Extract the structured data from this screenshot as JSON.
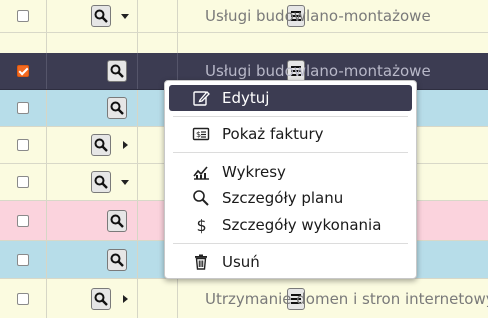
{
  "colors": {
    "row_yellow": "#fbfbe0",
    "row_selected": "#3c3c52",
    "row_blue": "#b7dde9",
    "row_pink": "#fbd3dd",
    "accent_checkbox": "#f26a21"
  },
  "rows": [
    {
      "checked": false,
      "expander": "down",
      "name": "Usługi budowlano-montażowe",
      "bg": "yellow"
    },
    {
      "checked": true,
      "expander": "none",
      "name": "Usługi budowlano-montażowe",
      "bg": "selected"
    },
    {
      "checked": false,
      "expander": "none",
      "name": "",
      "bg": "blue"
    },
    {
      "checked": false,
      "expander": "right",
      "name": "",
      "bg": "yellow"
    },
    {
      "checked": false,
      "expander": "down",
      "name": "",
      "bg": "yellow"
    },
    {
      "checked": false,
      "expander": "none",
      "name": "",
      "bg": "pink"
    },
    {
      "checked": false,
      "expander": "none",
      "name": "",
      "bg": "blue"
    },
    {
      "checked": false,
      "expander": "right",
      "name": "Utrzymanie domen i stron internetowych",
      "bg": "yellow"
    }
  ],
  "context_menu": {
    "items": [
      {
        "label": "Edytuj",
        "icon": "edit-icon",
        "active": true
      },
      {
        "label": "Pokaż faktury",
        "icon": "invoice-icon",
        "active": false
      },
      {
        "label": "Wykresy",
        "icon": "chart-icon",
        "active": false
      },
      {
        "label": "Szczegóły planu",
        "icon": "search-icon",
        "active": false
      },
      {
        "label": "Szczegóły wykonania",
        "icon": "dollar-icon",
        "active": false
      },
      {
        "label": "Usuń",
        "icon": "trash-icon",
        "active": false
      }
    ]
  }
}
